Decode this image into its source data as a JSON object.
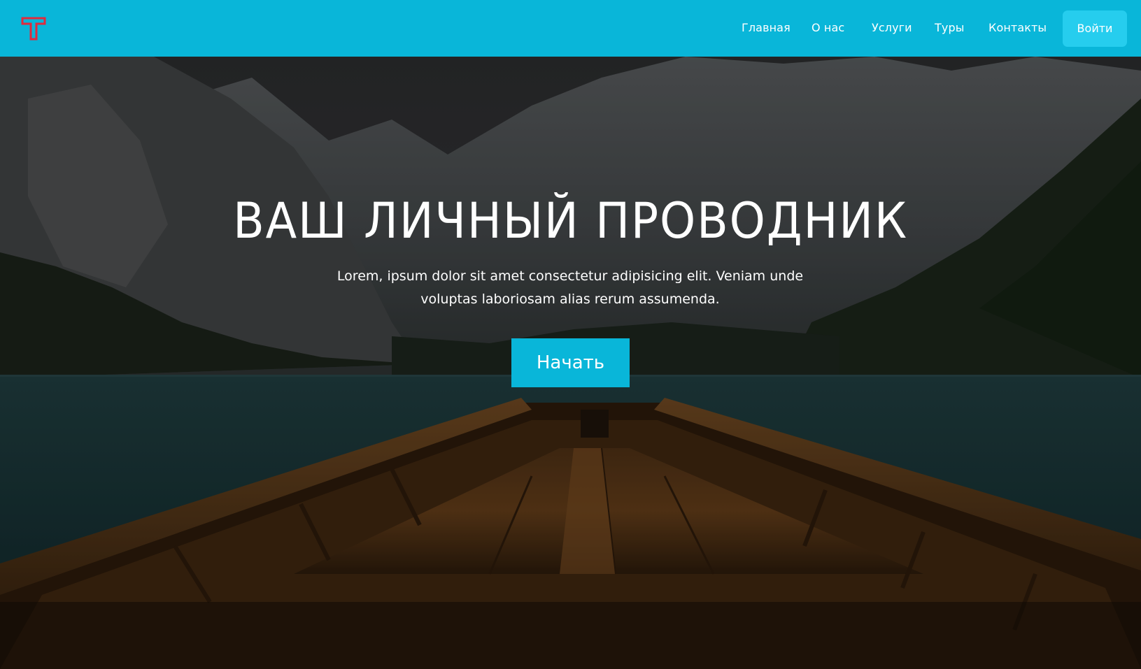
{
  "header": {
    "logo_icon": "letter-t-logo-icon",
    "nav": [
      {
        "label": "Главная"
      },
      {
        "label": "О нас"
      },
      {
        "label": "Услуги"
      },
      {
        "label": "Туры"
      },
      {
        "label": "Контакты"
      }
    ],
    "login_label": "Войти"
  },
  "hero": {
    "title": "ВАШ ЛИЧНЫЙ ПРОВОДНИК",
    "text": "Lorem, ipsum dolor sit amet consectetur adipisicing elit. Veniam unde voluptas laboriosam alias rerum assumenda.",
    "cta_label": "Начать",
    "background_image": "lake-mountains-boat-bow-photo"
  },
  "colors": {
    "accent": "#09b6d9",
    "accent_light": "#26cdee",
    "logo": "#e02b3d",
    "text": "#ffffff"
  }
}
